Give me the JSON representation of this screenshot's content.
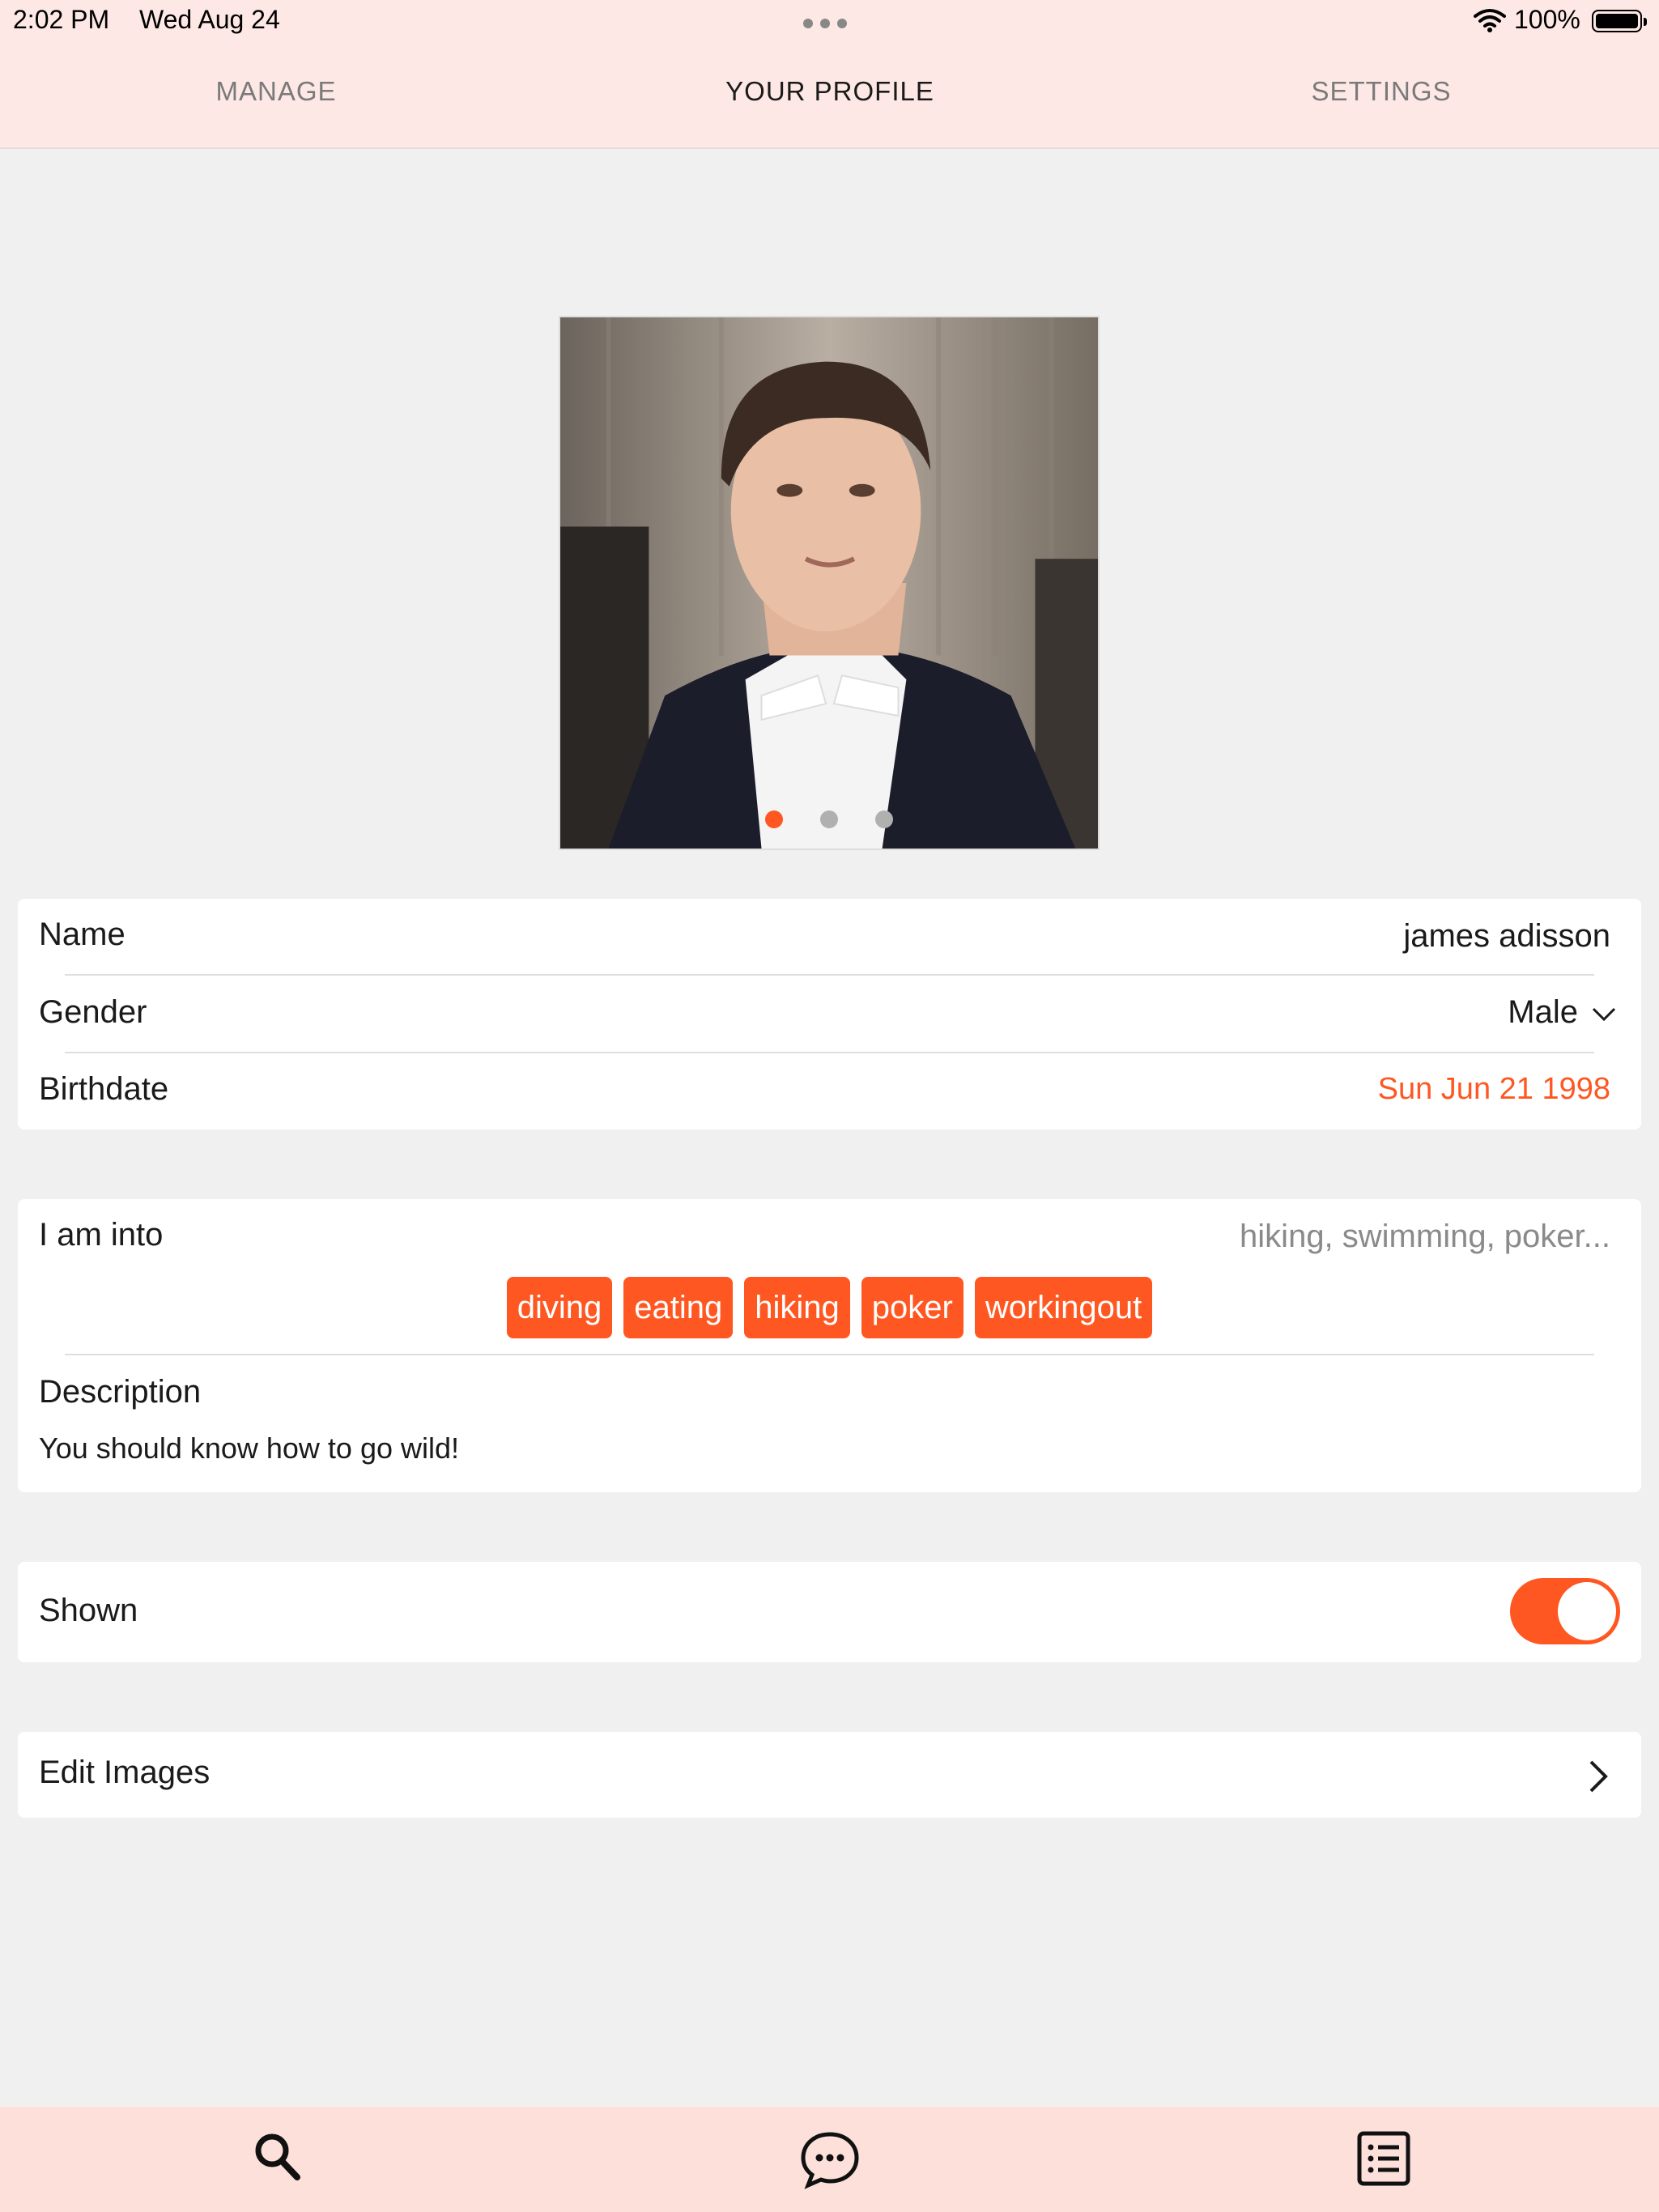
{
  "status_bar": {
    "time": "2:02 PM",
    "date": "Wed Aug 24",
    "battery_label": "100%",
    "battery_level": 1.0,
    "icons": [
      "wifi-icon",
      "battery-icon",
      "multitask-dots-icon"
    ]
  },
  "tabs": [
    {
      "label": "MANAGE",
      "active": false
    },
    {
      "label": "YOUR PROFILE",
      "active": true
    },
    {
      "label": "SETTINGS",
      "active": false
    }
  ],
  "photo": {
    "page_count": 3,
    "current_page": 1
  },
  "profile": {
    "name_label": "Name",
    "name_value": "james adisson",
    "gender_label": "Gender",
    "gender_value": "Male",
    "birthdate_label": "Birthdate",
    "birthdate_value": "Sun Jun 21 1998"
  },
  "interests": {
    "label": "I am into",
    "placeholder": "hiking, swimming, poker...",
    "tags": [
      "diving",
      "eating",
      "hiking",
      "poker",
      "workingout"
    ],
    "description_label": "Description",
    "description_value": "You should know how to go wild!"
  },
  "visibility": {
    "label": "Shown",
    "enabled": true
  },
  "edit_images": {
    "label": "Edit Images"
  },
  "bottom_bar": {
    "icons": [
      "search-icon",
      "chat-icon",
      "list-icon"
    ]
  },
  "colors": {
    "accent": "#ff5722",
    "bar_background": "#fde8e5",
    "page_background": "#f0f0f0"
  }
}
